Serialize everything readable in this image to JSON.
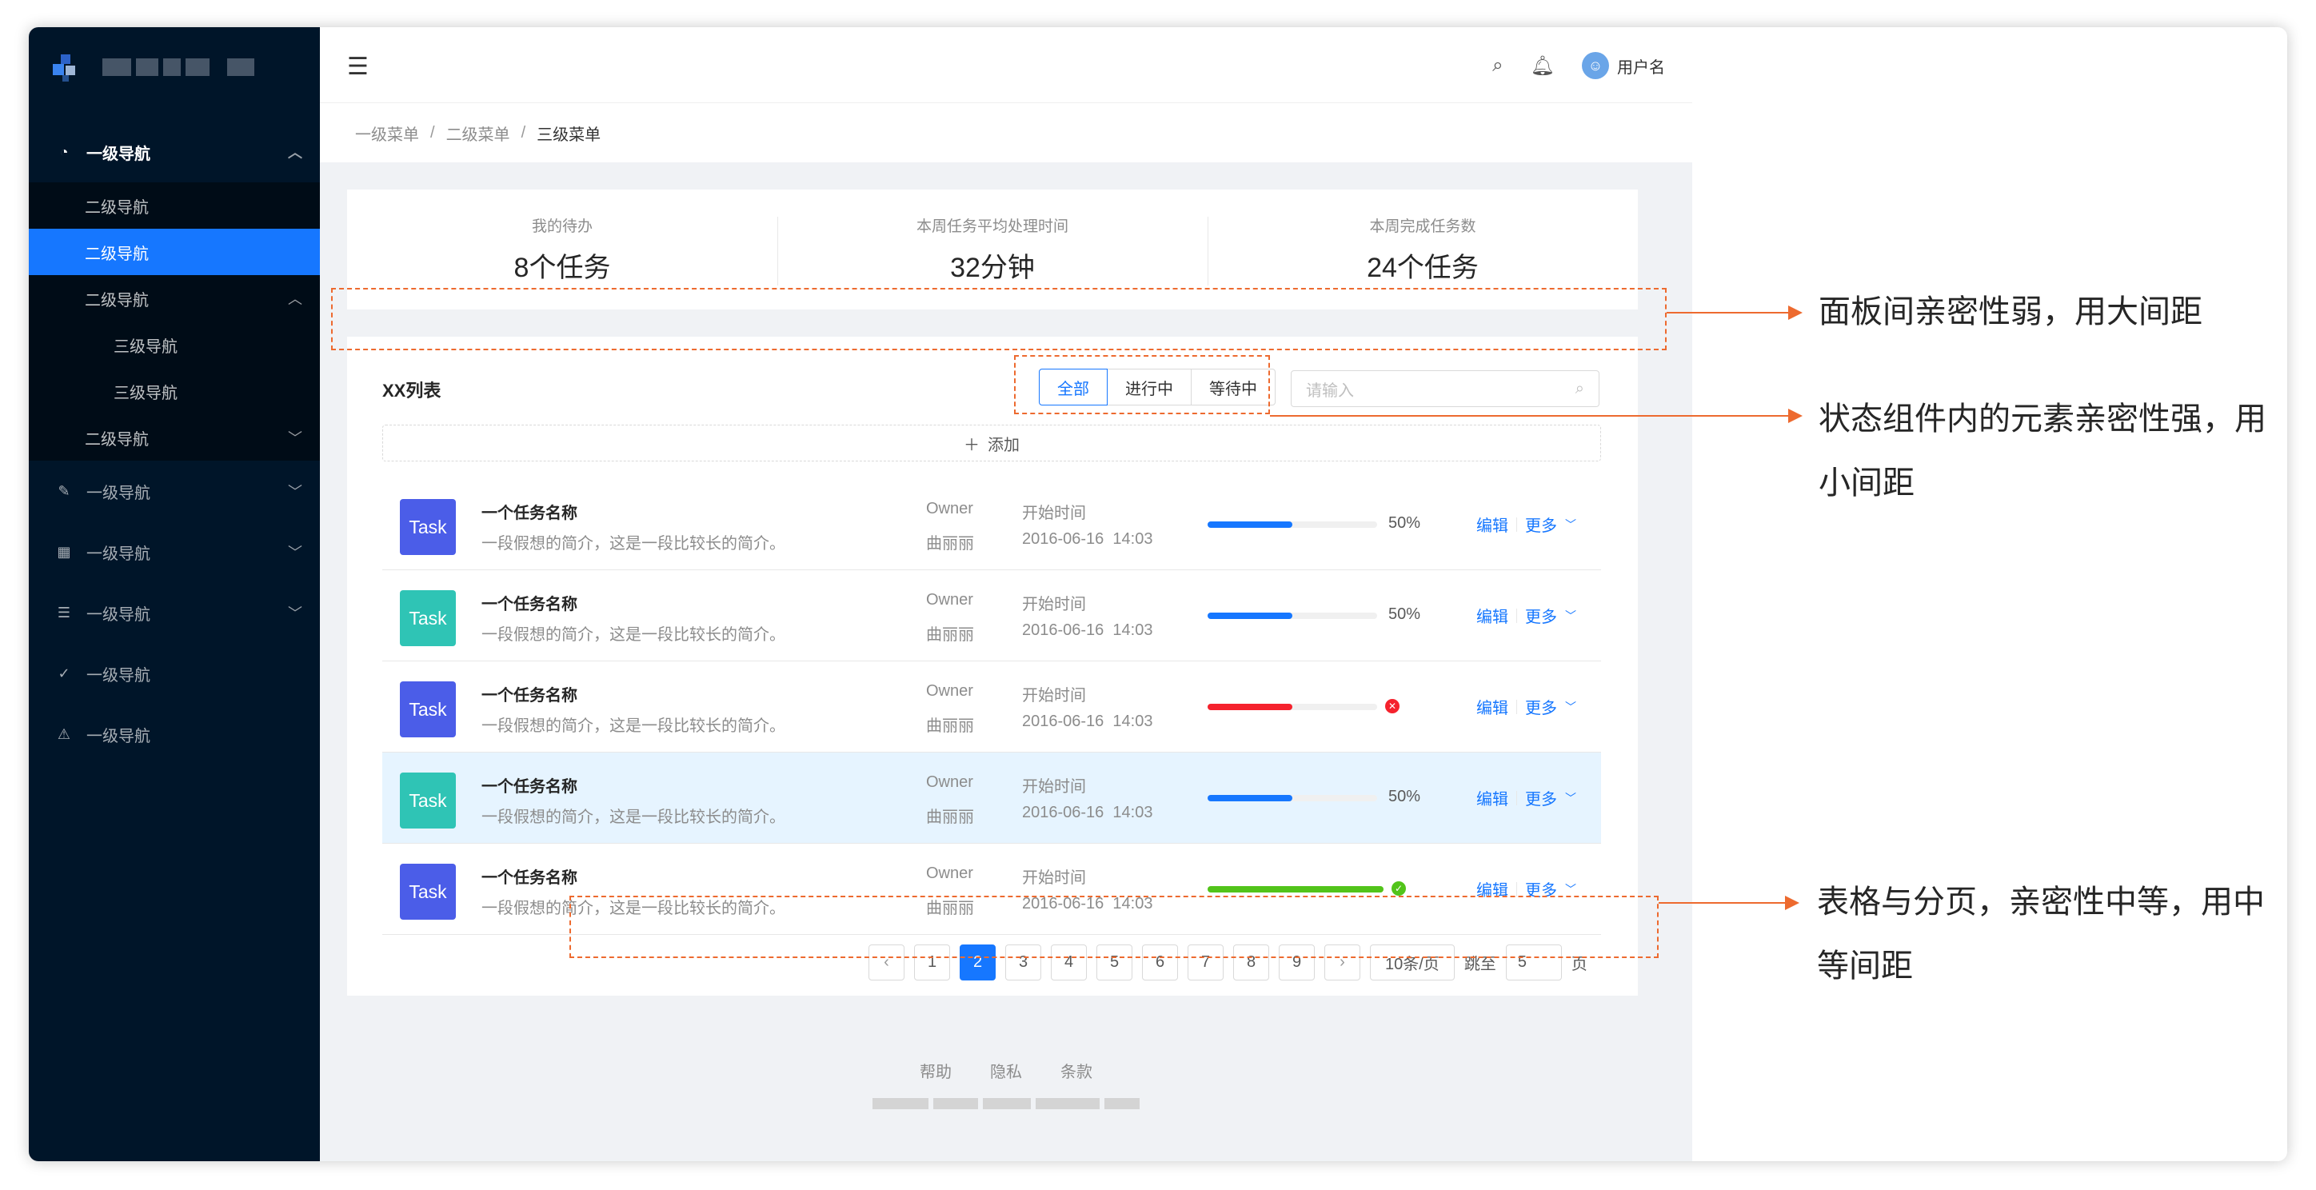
{
  "sidebar": {
    "nav": [
      {
        "label": "一级导航",
        "icon": "dashboard-icon",
        "open": true
      },
      {
        "label": "二级导航"
      },
      {
        "label": "二级导航",
        "active": true
      },
      {
        "label": "二级导航"
      },
      {
        "label": "三级导航"
      },
      {
        "label": "三级导航"
      },
      {
        "label": "二级导航"
      },
      {
        "label": "一级导航",
        "icon": "edit-icon"
      },
      {
        "label": "一级导航",
        "icon": "table-icon"
      },
      {
        "label": "一级导航",
        "icon": "profile-icon"
      },
      {
        "label": "一级导航",
        "icon": "check-circle-icon"
      },
      {
        "label": "一级导航",
        "icon": "warning-icon"
      }
    ]
  },
  "header": {
    "username": "用户名"
  },
  "breadcrumb": [
    "一级菜单",
    "二级菜单",
    "三级菜单"
  ],
  "stats": [
    {
      "label": "我的待办",
      "value": "8个任务"
    },
    {
      "label": "本周任务平均处理时间",
      "value": "32分钟"
    },
    {
      "label": "本周完成任务数",
      "value": "24个任务"
    }
  ],
  "list": {
    "title": "XX列表",
    "filters": [
      "全部",
      "进行中",
      "等待中"
    ],
    "active_filter": "全部",
    "search_placeholder": "请输入",
    "add_label": "添加",
    "rows": [
      {
        "badge": "Task",
        "badge_color": "#4b5de8",
        "name": "一个任务名称",
        "desc": "一段假想的简介，这是一段比较长的简介。",
        "owner_label": "Owner",
        "owner": "曲丽丽",
        "time_label": "开始时间",
        "time": "2016-06-16  14:03",
        "progress": 0.5,
        "progress_text": "50%",
        "status": "normal",
        "edit": "编辑",
        "more": "更多"
      },
      {
        "badge": "Task",
        "badge_color": "#2fc4b5",
        "name": "一个任务名称",
        "desc": "一段假想的简介，这是一段比较长的简介。",
        "owner_label": "Owner",
        "owner": "曲丽丽",
        "time_label": "开始时间",
        "time": "2016-06-16  14:03",
        "progress": 0.5,
        "progress_text": "50%",
        "status": "normal",
        "edit": "编辑",
        "more": "更多"
      },
      {
        "badge": "Task",
        "badge_color": "#4b5de8",
        "name": "一个任务名称",
        "desc": "一段假想的简介，这是一段比较长的简介。",
        "owner_label": "Owner",
        "owner": "曲丽丽",
        "time_label": "开始时间",
        "time": "2016-06-16  14:03",
        "progress": 0.5,
        "progress_text": "",
        "status": "exception",
        "edit": "编辑",
        "more": "更多"
      },
      {
        "badge": "Task",
        "badge_color": "#2fc4b5",
        "name": "一个任务名称",
        "desc": "一段假想的简介，这是一段比较长的简介。",
        "owner_label": "Owner",
        "owner": "曲丽丽",
        "time_label": "开始时间",
        "time": "2016-06-16  14:03",
        "progress": 0.5,
        "progress_text": "50%",
        "status": "normal",
        "edit": "编辑",
        "more": "更多",
        "highlight": true
      },
      {
        "badge": "Task",
        "badge_color": "#4b5de8",
        "name": "一个任务名称",
        "desc": "一段假想的简介，这是一段比较长的简介。",
        "owner_label": "Owner",
        "owner": "曲丽丽",
        "time_label": "开始时间",
        "time": "2016-06-16  14:03",
        "progress": 1.0,
        "progress_text": "",
        "status": "success",
        "edit": "编辑",
        "more": "更多"
      }
    ]
  },
  "pagination": {
    "pages": [
      "1",
      "2",
      "3",
      "4",
      "5",
      "6",
      "7",
      "8",
      "9"
    ],
    "current": "2",
    "page_size": "10条/页",
    "jump_label": "跳至",
    "jump_value": "5",
    "page_unit": "页"
  },
  "footer": {
    "links": [
      "帮助",
      "隐私",
      "条款"
    ]
  },
  "annotations": [
    {
      "text": "面板间亲密性弱，用大间距"
    },
    {
      "text": "状态组件内的元素亲密性强，用小间距"
    },
    {
      "text": "表格与分页，亲密性中等，用中等间距"
    }
  ],
  "colors": {
    "sider_bg": "#001529",
    "primary": "#1677ff",
    "annotation": "#ed6a2f",
    "progress_normal": "#1677ff",
    "progress_exception": "#f5222d",
    "progress_success": "#52c41a"
  }
}
